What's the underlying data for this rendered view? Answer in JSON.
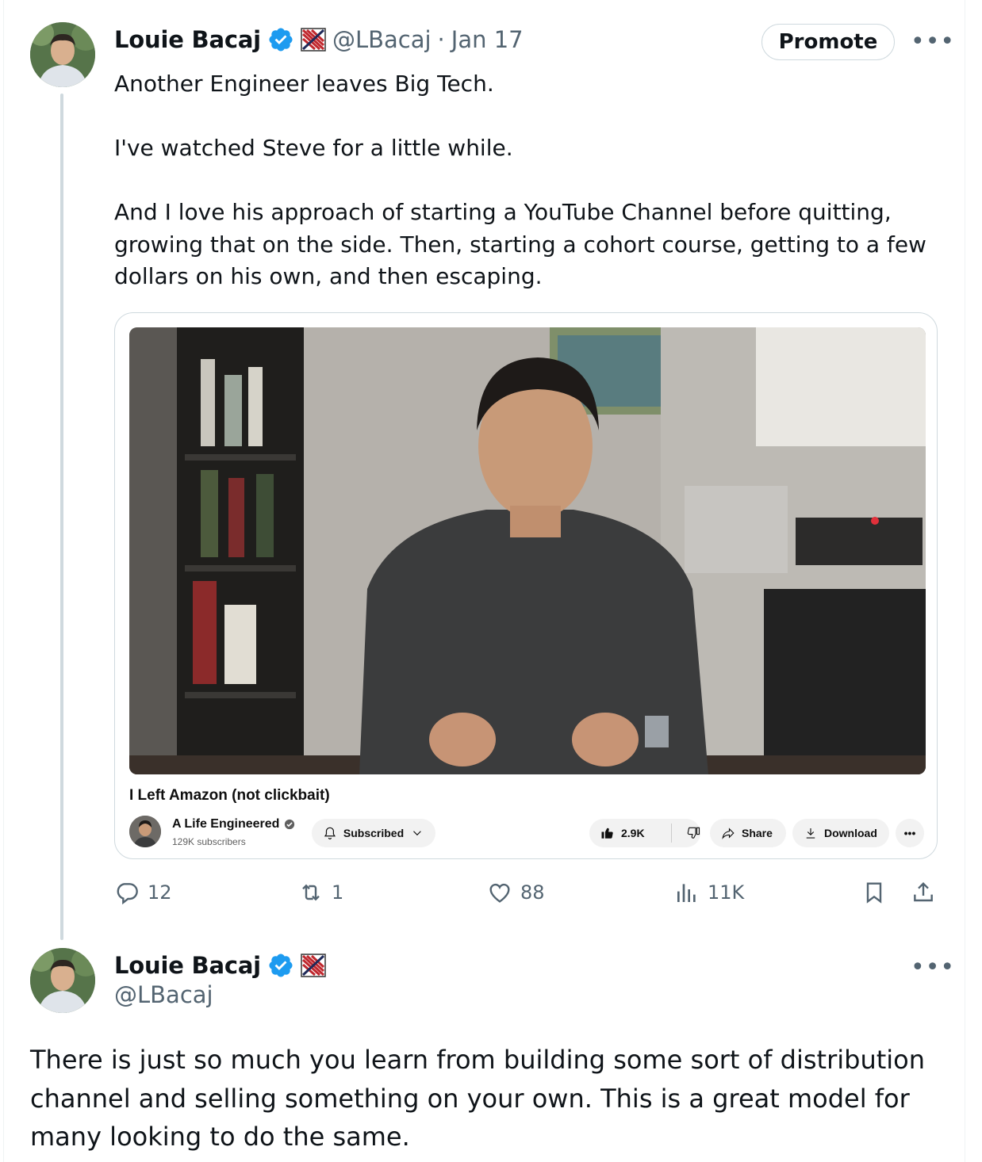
{
  "tweet": {
    "author_name": "Louie Bacaj",
    "handle": "@LBacaj",
    "date": "Jan 17",
    "separator": "·",
    "promote_label": "Promote",
    "text": "Another Engineer leaves Big Tech.\n\nI've watched Steve for a little while.\n\nAnd I love his approach of starting a YouTube Channel before quitting, growing that on the side. Then, starting a cohort course, getting to a few dollars on his own, and then escaping.",
    "card": {
      "video_title": "I Left Amazon (not clickbait)",
      "channel_name": "A Life Engineered",
      "channel_subscribers": "129K subscribers",
      "subscribed_label": "Subscribed",
      "likes": "2.9K",
      "share_label": "Share",
      "download_label": "Download"
    },
    "stats": {
      "replies": "12",
      "reposts": "1",
      "likes": "88",
      "views": "11K"
    }
  },
  "reply": {
    "author_name": "Louie Bacaj",
    "handle": "@LBacaj",
    "text": "There is just so much you learn from building some sort of distribution channel and selling something on your own. This is a great model for many looking to do the same."
  },
  "colors": {
    "verified": "#1d9bf0",
    "text": "#0f1419",
    "muted": "#536471",
    "border": "#cfd9de"
  },
  "icons": [
    "verified-badge-icon",
    "flag-emoji-icon",
    "more-options-icon",
    "reply-icon",
    "repost-icon",
    "like-icon",
    "views-icon",
    "bookmark-icon",
    "share-icon",
    "bell-icon",
    "chevron-down-icon",
    "thumbs-up-icon",
    "thumbs-down-icon",
    "forward-arrow-icon",
    "download-icon"
  ]
}
